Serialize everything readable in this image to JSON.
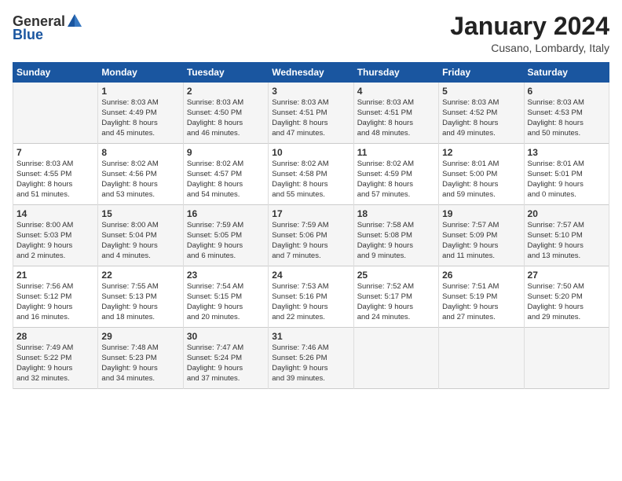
{
  "header": {
    "logo_general": "General",
    "logo_blue": "Blue",
    "month_year": "January 2024",
    "location": "Cusano, Lombardy, Italy"
  },
  "weekdays": [
    "Sunday",
    "Monday",
    "Tuesday",
    "Wednesday",
    "Thursday",
    "Friday",
    "Saturday"
  ],
  "weeks": [
    [
      {
        "day": "",
        "info": ""
      },
      {
        "day": "1",
        "info": "Sunrise: 8:03 AM\nSunset: 4:49 PM\nDaylight: 8 hours\nand 45 minutes."
      },
      {
        "day": "2",
        "info": "Sunrise: 8:03 AM\nSunset: 4:50 PM\nDaylight: 8 hours\nand 46 minutes."
      },
      {
        "day": "3",
        "info": "Sunrise: 8:03 AM\nSunset: 4:51 PM\nDaylight: 8 hours\nand 47 minutes."
      },
      {
        "day": "4",
        "info": "Sunrise: 8:03 AM\nSunset: 4:51 PM\nDaylight: 8 hours\nand 48 minutes."
      },
      {
        "day": "5",
        "info": "Sunrise: 8:03 AM\nSunset: 4:52 PM\nDaylight: 8 hours\nand 49 minutes."
      },
      {
        "day": "6",
        "info": "Sunrise: 8:03 AM\nSunset: 4:53 PM\nDaylight: 8 hours\nand 50 minutes."
      }
    ],
    [
      {
        "day": "7",
        "info": "Sunrise: 8:03 AM\nSunset: 4:55 PM\nDaylight: 8 hours\nand 51 minutes."
      },
      {
        "day": "8",
        "info": "Sunrise: 8:02 AM\nSunset: 4:56 PM\nDaylight: 8 hours\nand 53 minutes."
      },
      {
        "day": "9",
        "info": "Sunrise: 8:02 AM\nSunset: 4:57 PM\nDaylight: 8 hours\nand 54 minutes."
      },
      {
        "day": "10",
        "info": "Sunrise: 8:02 AM\nSunset: 4:58 PM\nDaylight: 8 hours\nand 55 minutes."
      },
      {
        "day": "11",
        "info": "Sunrise: 8:02 AM\nSunset: 4:59 PM\nDaylight: 8 hours\nand 57 minutes."
      },
      {
        "day": "12",
        "info": "Sunrise: 8:01 AM\nSunset: 5:00 PM\nDaylight: 8 hours\nand 59 minutes."
      },
      {
        "day": "13",
        "info": "Sunrise: 8:01 AM\nSunset: 5:01 PM\nDaylight: 9 hours\nand 0 minutes."
      }
    ],
    [
      {
        "day": "14",
        "info": "Sunrise: 8:00 AM\nSunset: 5:03 PM\nDaylight: 9 hours\nand 2 minutes."
      },
      {
        "day": "15",
        "info": "Sunrise: 8:00 AM\nSunset: 5:04 PM\nDaylight: 9 hours\nand 4 minutes."
      },
      {
        "day": "16",
        "info": "Sunrise: 7:59 AM\nSunset: 5:05 PM\nDaylight: 9 hours\nand 6 minutes."
      },
      {
        "day": "17",
        "info": "Sunrise: 7:59 AM\nSunset: 5:06 PM\nDaylight: 9 hours\nand 7 minutes."
      },
      {
        "day": "18",
        "info": "Sunrise: 7:58 AM\nSunset: 5:08 PM\nDaylight: 9 hours\nand 9 minutes."
      },
      {
        "day": "19",
        "info": "Sunrise: 7:57 AM\nSunset: 5:09 PM\nDaylight: 9 hours\nand 11 minutes."
      },
      {
        "day": "20",
        "info": "Sunrise: 7:57 AM\nSunset: 5:10 PM\nDaylight: 9 hours\nand 13 minutes."
      }
    ],
    [
      {
        "day": "21",
        "info": "Sunrise: 7:56 AM\nSunset: 5:12 PM\nDaylight: 9 hours\nand 16 minutes."
      },
      {
        "day": "22",
        "info": "Sunrise: 7:55 AM\nSunset: 5:13 PM\nDaylight: 9 hours\nand 18 minutes."
      },
      {
        "day": "23",
        "info": "Sunrise: 7:54 AM\nSunset: 5:15 PM\nDaylight: 9 hours\nand 20 minutes."
      },
      {
        "day": "24",
        "info": "Sunrise: 7:53 AM\nSunset: 5:16 PM\nDaylight: 9 hours\nand 22 minutes."
      },
      {
        "day": "25",
        "info": "Sunrise: 7:52 AM\nSunset: 5:17 PM\nDaylight: 9 hours\nand 24 minutes."
      },
      {
        "day": "26",
        "info": "Sunrise: 7:51 AM\nSunset: 5:19 PM\nDaylight: 9 hours\nand 27 minutes."
      },
      {
        "day": "27",
        "info": "Sunrise: 7:50 AM\nSunset: 5:20 PM\nDaylight: 9 hours\nand 29 minutes."
      }
    ],
    [
      {
        "day": "28",
        "info": "Sunrise: 7:49 AM\nSunset: 5:22 PM\nDaylight: 9 hours\nand 32 minutes."
      },
      {
        "day": "29",
        "info": "Sunrise: 7:48 AM\nSunset: 5:23 PM\nDaylight: 9 hours\nand 34 minutes."
      },
      {
        "day": "30",
        "info": "Sunrise: 7:47 AM\nSunset: 5:24 PM\nDaylight: 9 hours\nand 37 minutes."
      },
      {
        "day": "31",
        "info": "Sunrise: 7:46 AM\nSunset: 5:26 PM\nDaylight: 9 hours\nand 39 minutes."
      },
      {
        "day": "",
        "info": ""
      },
      {
        "day": "",
        "info": ""
      },
      {
        "day": "",
        "info": ""
      }
    ]
  ]
}
